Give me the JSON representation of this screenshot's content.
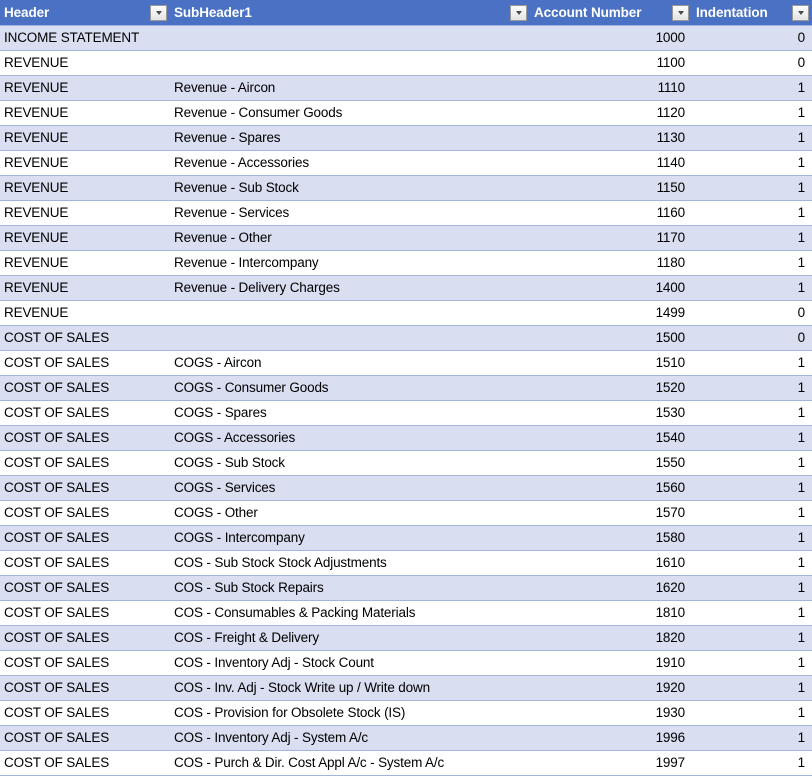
{
  "table": {
    "columns": [
      {
        "label": "Header",
        "key": "header",
        "align": "left",
        "filter_icon": "chevron-down-icon"
      },
      {
        "label": "SubHeader1",
        "key": "subheader1",
        "align": "left",
        "filter_icon": "chevron-down-icon"
      },
      {
        "label": "Account Number",
        "key": "account",
        "align": "right",
        "filter_icon": "chevron-down-icon"
      },
      {
        "label": "Indentation",
        "key": "indentation",
        "align": "right",
        "filter_icon": "chevron-down-icon"
      }
    ],
    "colors": {
      "header_background": "#4A71C4",
      "header_text": "#FFFFFF",
      "band_row": "#D9DEF0",
      "plain_row": "#FFFFFF",
      "row_border": "#A3B4DC",
      "cell_text": "#000000"
    },
    "rows": [
      {
        "header": "INCOME STATEMENT",
        "subheader1": "",
        "account": "1000",
        "indentation": "0"
      },
      {
        "header": "REVENUE",
        "subheader1": "",
        "account": "1100",
        "indentation": "0"
      },
      {
        "header": "REVENUE",
        "subheader1": "Revenue - Aircon",
        "account": "1110",
        "indentation": "1"
      },
      {
        "header": "REVENUE",
        "subheader1": "Revenue - Consumer Goods",
        "account": "1120",
        "indentation": "1"
      },
      {
        "header": "REVENUE",
        "subheader1": "Revenue - Spares",
        "account": "1130",
        "indentation": "1"
      },
      {
        "header": "REVENUE",
        "subheader1": "Revenue - Accessories",
        "account": "1140",
        "indentation": "1"
      },
      {
        "header": "REVENUE",
        "subheader1": "Revenue - Sub Stock",
        "account": "1150",
        "indentation": "1"
      },
      {
        "header": "REVENUE",
        "subheader1": "Revenue - Services",
        "account": "1160",
        "indentation": "1"
      },
      {
        "header": "REVENUE",
        "subheader1": "Revenue - Other",
        "account": "1170",
        "indentation": "1"
      },
      {
        "header": "REVENUE",
        "subheader1": "Revenue - Intercompany",
        "account": "1180",
        "indentation": "1"
      },
      {
        "header": "REVENUE",
        "subheader1": "Revenue - Delivery Charges",
        "account": "1400",
        "indentation": "1"
      },
      {
        "header": "REVENUE",
        "subheader1": "",
        "account": "1499",
        "indentation": "0"
      },
      {
        "header": "COST OF SALES",
        "subheader1": "",
        "account": "1500",
        "indentation": "0"
      },
      {
        "header": "COST OF SALES",
        "subheader1": "COGS - Aircon",
        "account": "1510",
        "indentation": "1"
      },
      {
        "header": "COST OF SALES",
        "subheader1": "COGS - Consumer Goods",
        "account": "1520",
        "indentation": "1"
      },
      {
        "header": "COST OF SALES",
        "subheader1": "COGS - Spares",
        "account": "1530",
        "indentation": "1"
      },
      {
        "header": "COST OF SALES",
        "subheader1": "COGS - Accessories",
        "account": "1540",
        "indentation": "1"
      },
      {
        "header": "COST OF SALES",
        "subheader1": "COGS - Sub Stock",
        "account": "1550",
        "indentation": "1"
      },
      {
        "header": "COST OF SALES",
        "subheader1": "COGS - Services",
        "account": "1560",
        "indentation": "1"
      },
      {
        "header": "COST OF SALES",
        "subheader1": "COGS - Other",
        "account": "1570",
        "indentation": "1"
      },
      {
        "header": "COST OF SALES",
        "subheader1": "COGS - Intercompany",
        "account": "1580",
        "indentation": "1"
      },
      {
        "header": "COST OF SALES",
        "subheader1": "COS - Sub Stock Stock Adjustments",
        "account": "1610",
        "indentation": "1"
      },
      {
        "header": "COST OF SALES",
        "subheader1": "COS - Sub Stock Repairs",
        "account": "1620",
        "indentation": "1"
      },
      {
        "header": "COST OF SALES",
        "subheader1": "COS - Consumables & Packing Materials",
        "account": "1810",
        "indentation": "1"
      },
      {
        "header": "COST OF SALES",
        "subheader1": "COS - Freight & Delivery",
        "account": "1820",
        "indentation": "1"
      },
      {
        "header": "COST OF SALES",
        "subheader1": "COS - Inventory Adj - Stock Count",
        "account": "1910",
        "indentation": "1"
      },
      {
        "header": "COST OF SALES",
        "subheader1": "COS - Inv. Adj - Stock Write up / Write down",
        "account": "1920",
        "indentation": "1"
      },
      {
        "header": "COST OF SALES",
        "subheader1": "COS - Provision for Obsolete Stock (IS)",
        "account": "1930",
        "indentation": "1"
      },
      {
        "header": "COST OF SALES",
        "subheader1": "COS - Inventory Adj - System A/c",
        "account": "1996",
        "indentation": "1"
      },
      {
        "header": "COST OF SALES",
        "subheader1": "COS - Purch & Dir. Cost Appl A/c - System A/c",
        "account": "1997",
        "indentation": "1"
      }
    ]
  }
}
